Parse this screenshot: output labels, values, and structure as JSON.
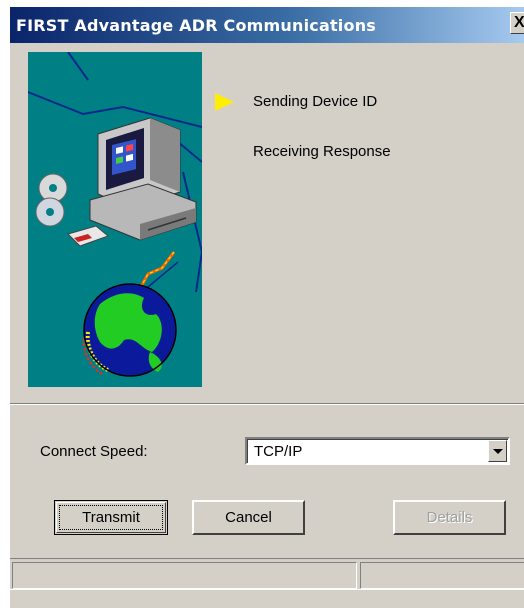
{
  "window": {
    "title": "FIRST Advantage ADR Communications",
    "close_label": "X"
  },
  "steps": [
    {
      "label": "Sending Device ID",
      "active": true
    },
    {
      "label": "Receiving Response",
      "active": false
    }
  ],
  "connect_speed": {
    "label": "Connect Speed:",
    "value": "TCP/IP"
  },
  "buttons": {
    "transmit_label": "Transmit",
    "cancel_label": "Cancel",
    "details_label": "Details"
  },
  "icons": {
    "illustration": "computer-globe-cd-illustration",
    "active_step": "yellow-arrow-icon",
    "dropdown": "chevron-down-icon"
  },
  "colors": {
    "illustration_bg": "#007f85",
    "active_arrow": "#ffee00",
    "titlebar_start": "#0a246a",
    "titlebar_end": "#a6caf0"
  }
}
